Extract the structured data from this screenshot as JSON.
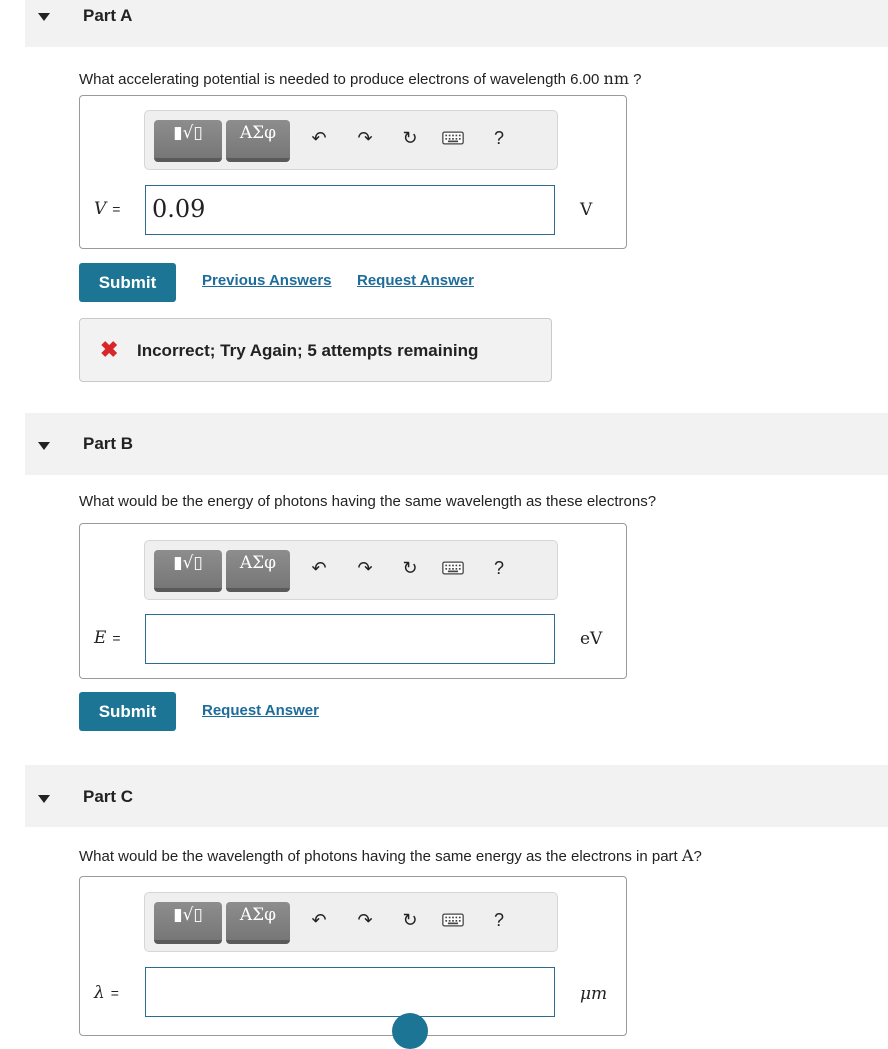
{
  "toolbar": {
    "templates_label": "▮√▯",
    "symbols_label": "ΑΣφ",
    "undo": "↶",
    "redo": "↷",
    "reset": "↻",
    "help": "?"
  },
  "part_a": {
    "title": "Part A",
    "question_prefix": "What accelerating potential is needed to produce electrons of wavelength 6.00",
    "question_unit": "nm",
    "question_suffix": " ?",
    "variable": "V",
    "equals": "=",
    "answer_value": "0.09",
    "unit": "V",
    "submit_label": "Submit",
    "previous_answers_label": "Previous Answers",
    "request_answer_label": "Request Answer",
    "feedback_icon": "✖",
    "feedback_text": "Incorrect; Try Again; 5 attempts remaining"
  },
  "part_b": {
    "title": "Part B",
    "question": "What would be the energy of photons having the same wavelength as these electrons?",
    "variable": "E",
    "equals": "=",
    "answer_value": "",
    "unit": "eV",
    "submit_label": "Submit",
    "request_answer_label": "Request Answer"
  },
  "part_c": {
    "title": "Part C",
    "question_prefix": "What would be the wavelength of photons having the same energy as the electrons in part",
    "question_part_ref": "A",
    "question_suffix": "?",
    "variable": "λ",
    "equals": "=",
    "answer_value": "",
    "unit": "μm"
  }
}
